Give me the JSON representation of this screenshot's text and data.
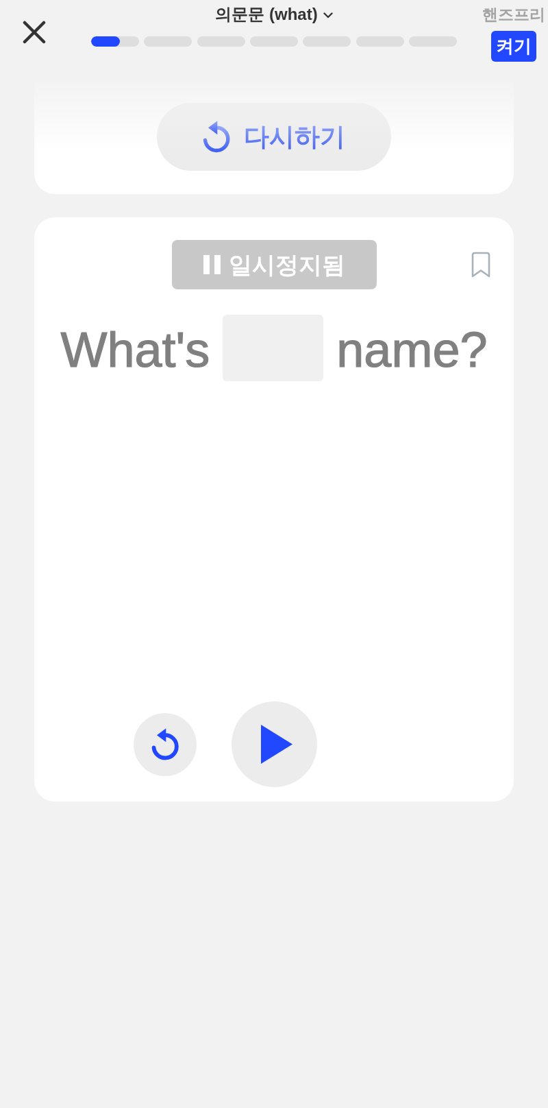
{
  "header": {
    "title": "의문문 (what)",
    "progress": [
      {
        "kind": "current",
        "level": 0.6
      },
      {
        "kind": "upcoming"
      },
      {
        "kind": "upcoming"
      },
      {
        "kind": "upcoming"
      },
      {
        "kind": "upcoming"
      },
      {
        "kind": "upcoming"
      },
      {
        "kind": "upcoming"
      }
    ],
    "handsfree": {
      "label": "핸즈프리",
      "button": "켜기"
    }
  },
  "retry_card": {
    "button": "다시하기"
  },
  "question_card": {
    "status": "일시정지됨",
    "paused": true,
    "bookmarked": false,
    "sentence": [
      {
        "kind": "text",
        "text": "What's"
      },
      {
        "kind": "blank"
      },
      {
        "kind": "text",
        "text": "name?"
      }
    ]
  }
}
